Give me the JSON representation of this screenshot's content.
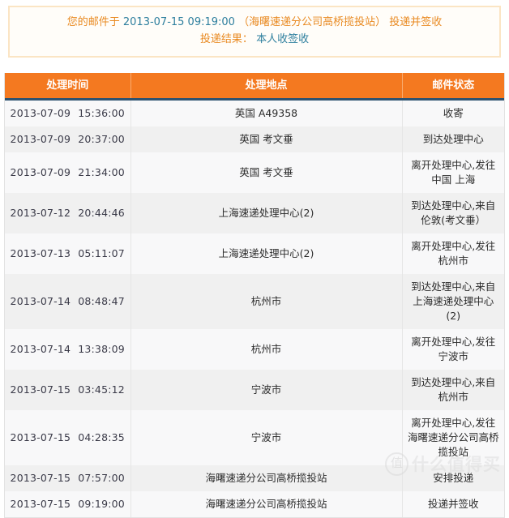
{
  "notice": {
    "line1_prefix": "您的邮件于",
    "line1_datetime": "2013-07-15 09:19:00",
    "line1_location": "（海曙速递分公司高桥揽投站）",
    "line1_suffix": "投递并签收",
    "line2_label": "投递结果：",
    "line2_value": "本人收签收"
  },
  "table": {
    "headers": [
      "处理时间",
      "处理地点",
      "邮件状态"
    ],
    "rows": [
      {
        "date": "2013-07-09",
        "time": "15:36:00",
        "place": "英国 A49358",
        "state": "收寄"
      },
      {
        "date": "2013-07-09",
        "time": "20:37:00",
        "place": "英国 考文垂",
        "state": "到达处理中心"
      },
      {
        "date": "2013-07-09",
        "time": "21:34:00",
        "place": "英国 考文垂",
        "state": "离开处理中心,发往中国 上海"
      },
      {
        "date": "2013-07-12",
        "time": "20:44:46",
        "place": "上海速递处理中心(2)",
        "state": "到达处理中心,来自伦敦(考文垂）"
      },
      {
        "date": "2013-07-13",
        "time": "05:11:07",
        "place": "上海速递处理中心(2)",
        "state": "离开处理中心,发往杭州市"
      },
      {
        "date": "2013-07-14",
        "time": "08:48:47",
        "place": "杭州市",
        "state": "到达处理中心,来自上海速递处理中心(2)"
      },
      {
        "date": "2013-07-14",
        "time": "13:38:09",
        "place": "杭州市",
        "state": "离开处理中心,发往宁波市"
      },
      {
        "date": "2013-07-15",
        "time": "03:45:12",
        "place": "宁波市",
        "state": "到达处理中心,来自杭州市"
      },
      {
        "date": "2013-07-15",
        "time": "04:28:35",
        "place": "宁波市",
        "state": "离开处理中心,发往海曙速递分公司高桥揽投站"
      },
      {
        "date": "2013-07-15",
        "time": "07:57:00",
        "place": "海曙速递分公司高桥揽投站",
        "state": "安排投递"
      },
      {
        "date": "2013-07-15",
        "time": "09:19:00",
        "place": "海曙速递分公司高桥揽投站",
        "state": "投递并签收"
      }
    ]
  },
  "watermark": {
    "badge": "值",
    "text": "什么值得买"
  },
  "colors": {
    "header_orange": "#f47920",
    "header_underline": "#2d5270",
    "notice_orange": "#e98a22",
    "notice_teal": "#2e7f9e",
    "notice_border": "#fbe5c4",
    "row_odd": "#f8f8f9",
    "row_even": "#f0f0f0"
  }
}
